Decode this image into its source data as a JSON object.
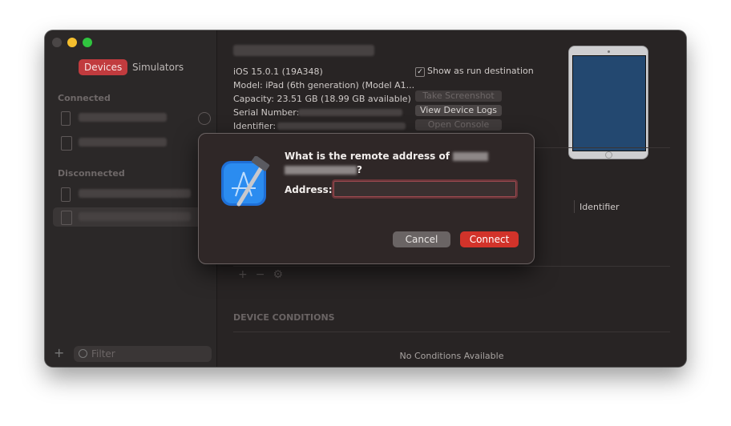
{
  "sidebar": {
    "tabs": {
      "devices": "Devices",
      "simulators": "Simulators"
    },
    "section_connected": "Connected",
    "section_disconnected": "Disconnected",
    "filter_placeholder": "Filter"
  },
  "device": {
    "ios": "iOS 15.0.1 (19A348)",
    "model": "Model: iPad (6th generation) (Model A1...",
    "capacity": "Capacity: 23.51 GB (18.99 GB available)",
    "serial_label": "Serial Number:",
    "identifier_label": "Identifier:",
    "show_as_run_destination": "Show as run destination",
    "show_as_run_destination_checked": true,
    "btn_take_screenshot": "Take Screenshot",
    "btn_view_device_logs": "View Device Logs",
    "btn_open_console": "Open Console"
  },
  "table": {
    "identifier_col": "Identifier"
  },
  "conditions": {
    "heading": "DEVICE CONDITIONS",
    "empty": "No Conditions Available"
  },
  "dialog": {
    "title_prefix": "What is the remote address of",
    "title_suffix": "?",
    "address_label": "Address:",
    "address_value": "",
    "cancel_label": "Cancel",
    "connect_label": "Connect"
  },
  "colors": {
    "accent": "#d2332a",
    "devices_tab": "#c13b3e",
    "ipad_screen": "#234870"
  }
}
